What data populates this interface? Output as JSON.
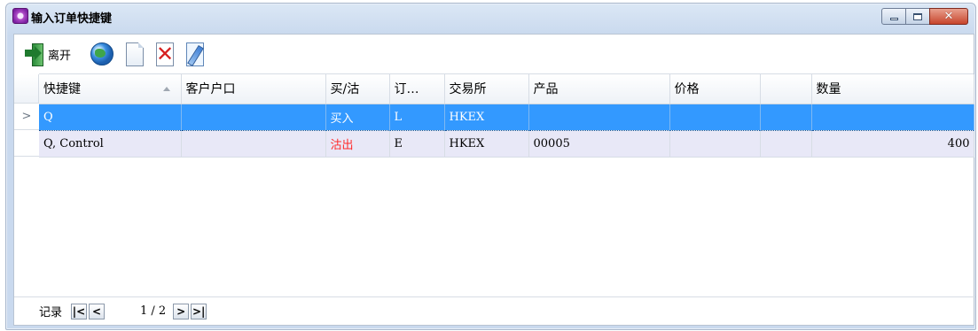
{
  "window": {
    "title": "输入订单快捷键",
    "icon": "app-icon",
    "controls": [
      "minimize-icon",
      "maximize-icon",
      "close-icon"
    ]
  },
  "toolbar": {
    "exit_label": "离开",
    "tools": [
      "exit-icon",
      "globe-icon",
      "new-document-icon",
      "delete-icon",
      "edit-icon"
    ]
  },
  "grid": {
    "columns": [
      "快捷键",
      "客户户口",
      "买/沽",
      "订…",
      "交易所",
      "产品",
      "价格",
      "",
      "数量"
    ],
    "sorted_column": "快捷键",
    "current_row_marker": ">",
    "rows": [
      {
        "key": "Q",
        "account": "",
        "side": "买入",
        "type": "L",
        "exchange": "HKEX",
        "product": "",
        "price": "",
        "extra": "",
        "qty": "",
        "selected": true
      },
      {
        "key": "Q, Control",
        "account": "",
        "side": "沽出",
        "type": "E",
        "exchange": "HKEX",
        "product": "00005",
        "price": "",
        "extra": "",
        "qty": "400",
        "selected": false
      }
    ]
  },
  "navigator": {
    "label": "记录",
    "first": "K",
    "prev": "<",
    "page_info": "1 / 2",
    "next": ">",
    "last": "K"
  },
  "colors": {
    "selection": "#3399ff",
    "alt_row": "#e8e8f7",
    "sell_text": "#ff2a2a"
  }
}
